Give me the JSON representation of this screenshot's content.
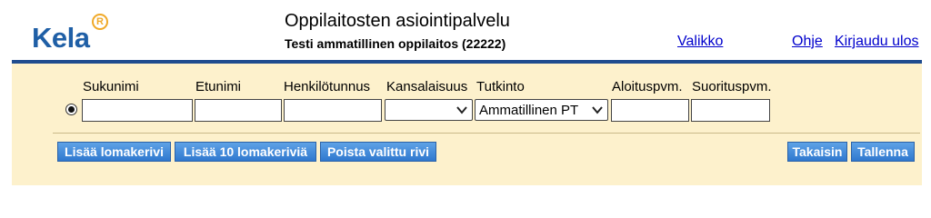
{
  "header": {
    "logo_text": "Kela",
    "logo_badge": "R",
    "app_title": "Oppilaitosten asiointipalvelu",
    "org_line": "Testi ammatillinen oppilaitos (22222)",
    "links": {
      "menu": "Valikko",
      "help": "Ohje",
      "logout": "Kirjaudu ulos"
    }
  },
  "form": {
    "columns": {
      "surname": "Sukunimi",
      "firstname": "Etunimi",
      "personal_id": "Henkilötunnus",
      "nationality": "Kansalaisuus",
      "degree": "Tutkinto",
      "start_date": "Aloituspvm.",
      "completion_date": "Suorituspvm."
    },
    "row": {
      "selected": true,
      "surname": "",
      "firstname": "",
      "personal_id": "",
      "nationality": "",
      "degree": "Ammatillinen PT",
      "start_date": "",
      "completion_date": ""
    }
  },
  "buttons": {
    "add_row": "Lisää lomakerivi",
    "add_10_rows": "Lisää 10 lomakeriviä",
    "delete_selected": "Poista valittu rivi",
    "back": "Takaisin",
    "save": "Tallenna"
  },
  "colors": {
    "brand_blue": "#1f5fa6",
    "badge_orange": "#f0a928",
    "panel_bg": "#fdf1cc",
    "divider": "#1f4c8f",
    "button_blue": "#2f78cf",
    "link": "#0000cc"
  }
}
